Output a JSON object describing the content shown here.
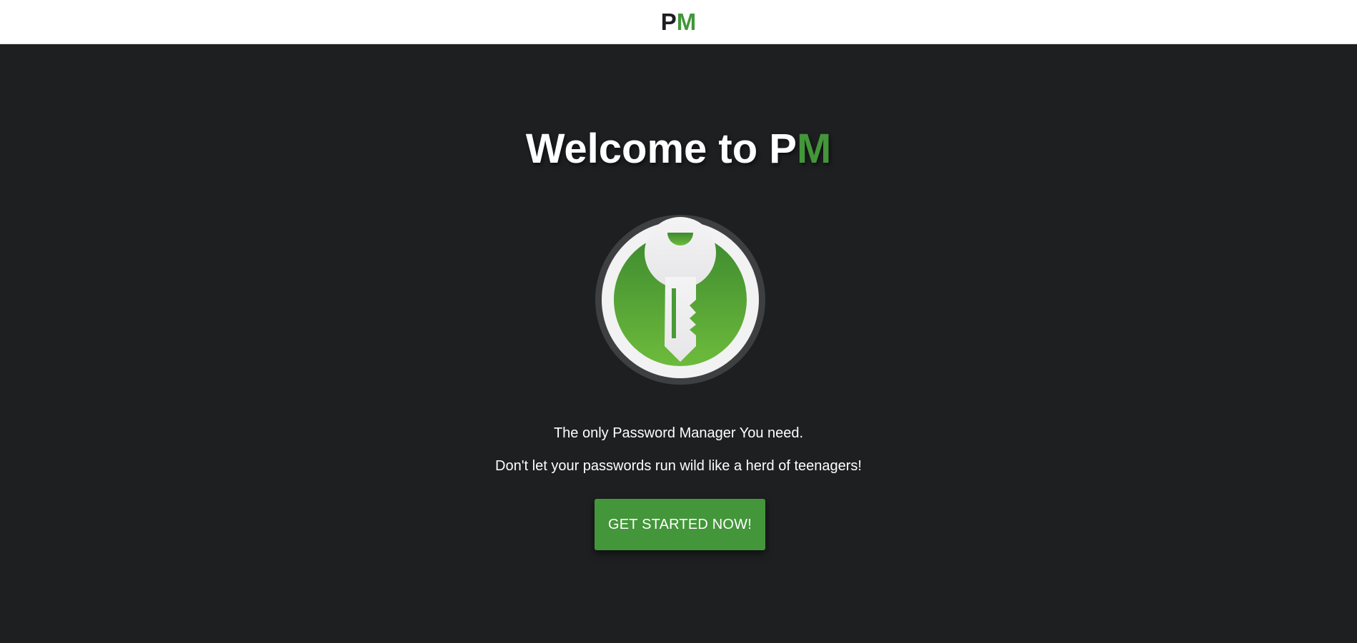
{
  "header": {
    "brand_p": "P",
    "brand_m": "M"
  },
  "hero": {
    "title_prefix": "Welcome to P",
    "title_accent": "M",
    "logo_icon": "key-icon",
    "tagline_1": "The only Password Manager You need.",
    "tagline_2": "Don't let your passwords run wild like a herd of teenagers!",
    "cta_label": "GET STARTED NOW!"
  },
  "colors": {
    "accent": "#43963a",
    "background": "#1e1f21",
    "header_bg": "#ffffff",
    "text": "#ffffff"
  }
}
